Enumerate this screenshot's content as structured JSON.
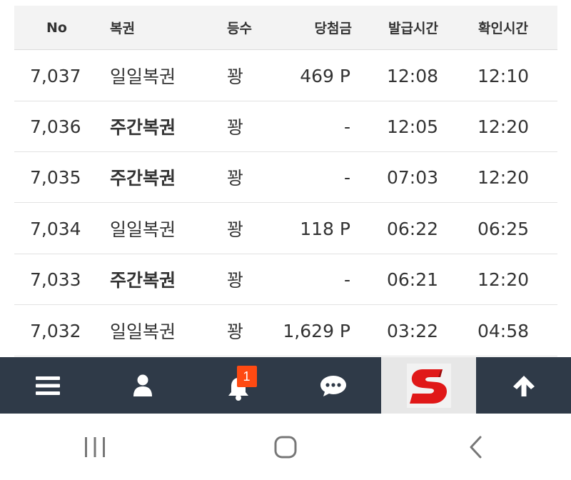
{
  "table": {
    "headers": {
      "no": "No",
      "type": "복권",
      "grade": "등수",
      "prize": "당첨금",
      "issued": "발급시간",
      "checked": "확인시간"
    },
    "rows": [
      {
        "no": "7,037",
        "type": "일일복권",
        "grade": "꽝",
        "prize": "469 P",
        "issued": "12:08",
        "checked": "12:10",
        "bold": false
      },
      {
        "no": "7,036",
        "type": "주간복권",
        "grade": "꽝",
        "prize": "-",
        "issued": "12:05",
        "checked": "12:20",
        "bold": true
      },
      {
        "no": "7,035",
        "type": "주간복권",
        "grade": "꽝",
        "prize": "-",
        "issued": "07:03",
        "checked": "12:20",
        "bold": true
      },
      {
        "no": "7,034",
        "type": "일일복권",
        "grade": "꽝",
        "prize": "118 P",
        "issued": "06:22",
        "checked": "06:25",
        "bold": false
      },
      {
        "no": "7,033",
        "type": "주간복권",
        "grade": "꽝",
        "prize": "-",
        "issued": "06:21",
        "checked": "12:20",
        "bold": true
      },
      {
        "no": "7,032",
        "type": "일일복권",
        "grade": "꽝",
        "prize": "1,629 P",
        "issued": "03:22",
        "checked": "04:58",
        "bold": false
      }
    ]
  },
  "bottom_nav": {
    "items": [
      {
        "icon": "menu-icon"
      },
      {
        "icon": "user-icon"
      },
      {
        "icon": "bell-icon",
        "badge": "1"
      },
      {
        "icon": "chat-icon"
      },
      {
        "icon": "logo-s-icon"
      },
      {
        "icon": "arrow-up-icon"
      }
    ]
  },
  "system_nav": {
    "items": [
      {
        "icon": "recent-apps-icon"
      },
      {
        "icon": "home-icon"
      },
      {
        "icon": "back-icon"
      }
    ]
  },
  "colors": {
    "nav_background": "#2f3a48",
    "badge": "#ff4a12",
    "logo_red": "#e01818",
    "header_background": "#f3f3f3"
  }
}
